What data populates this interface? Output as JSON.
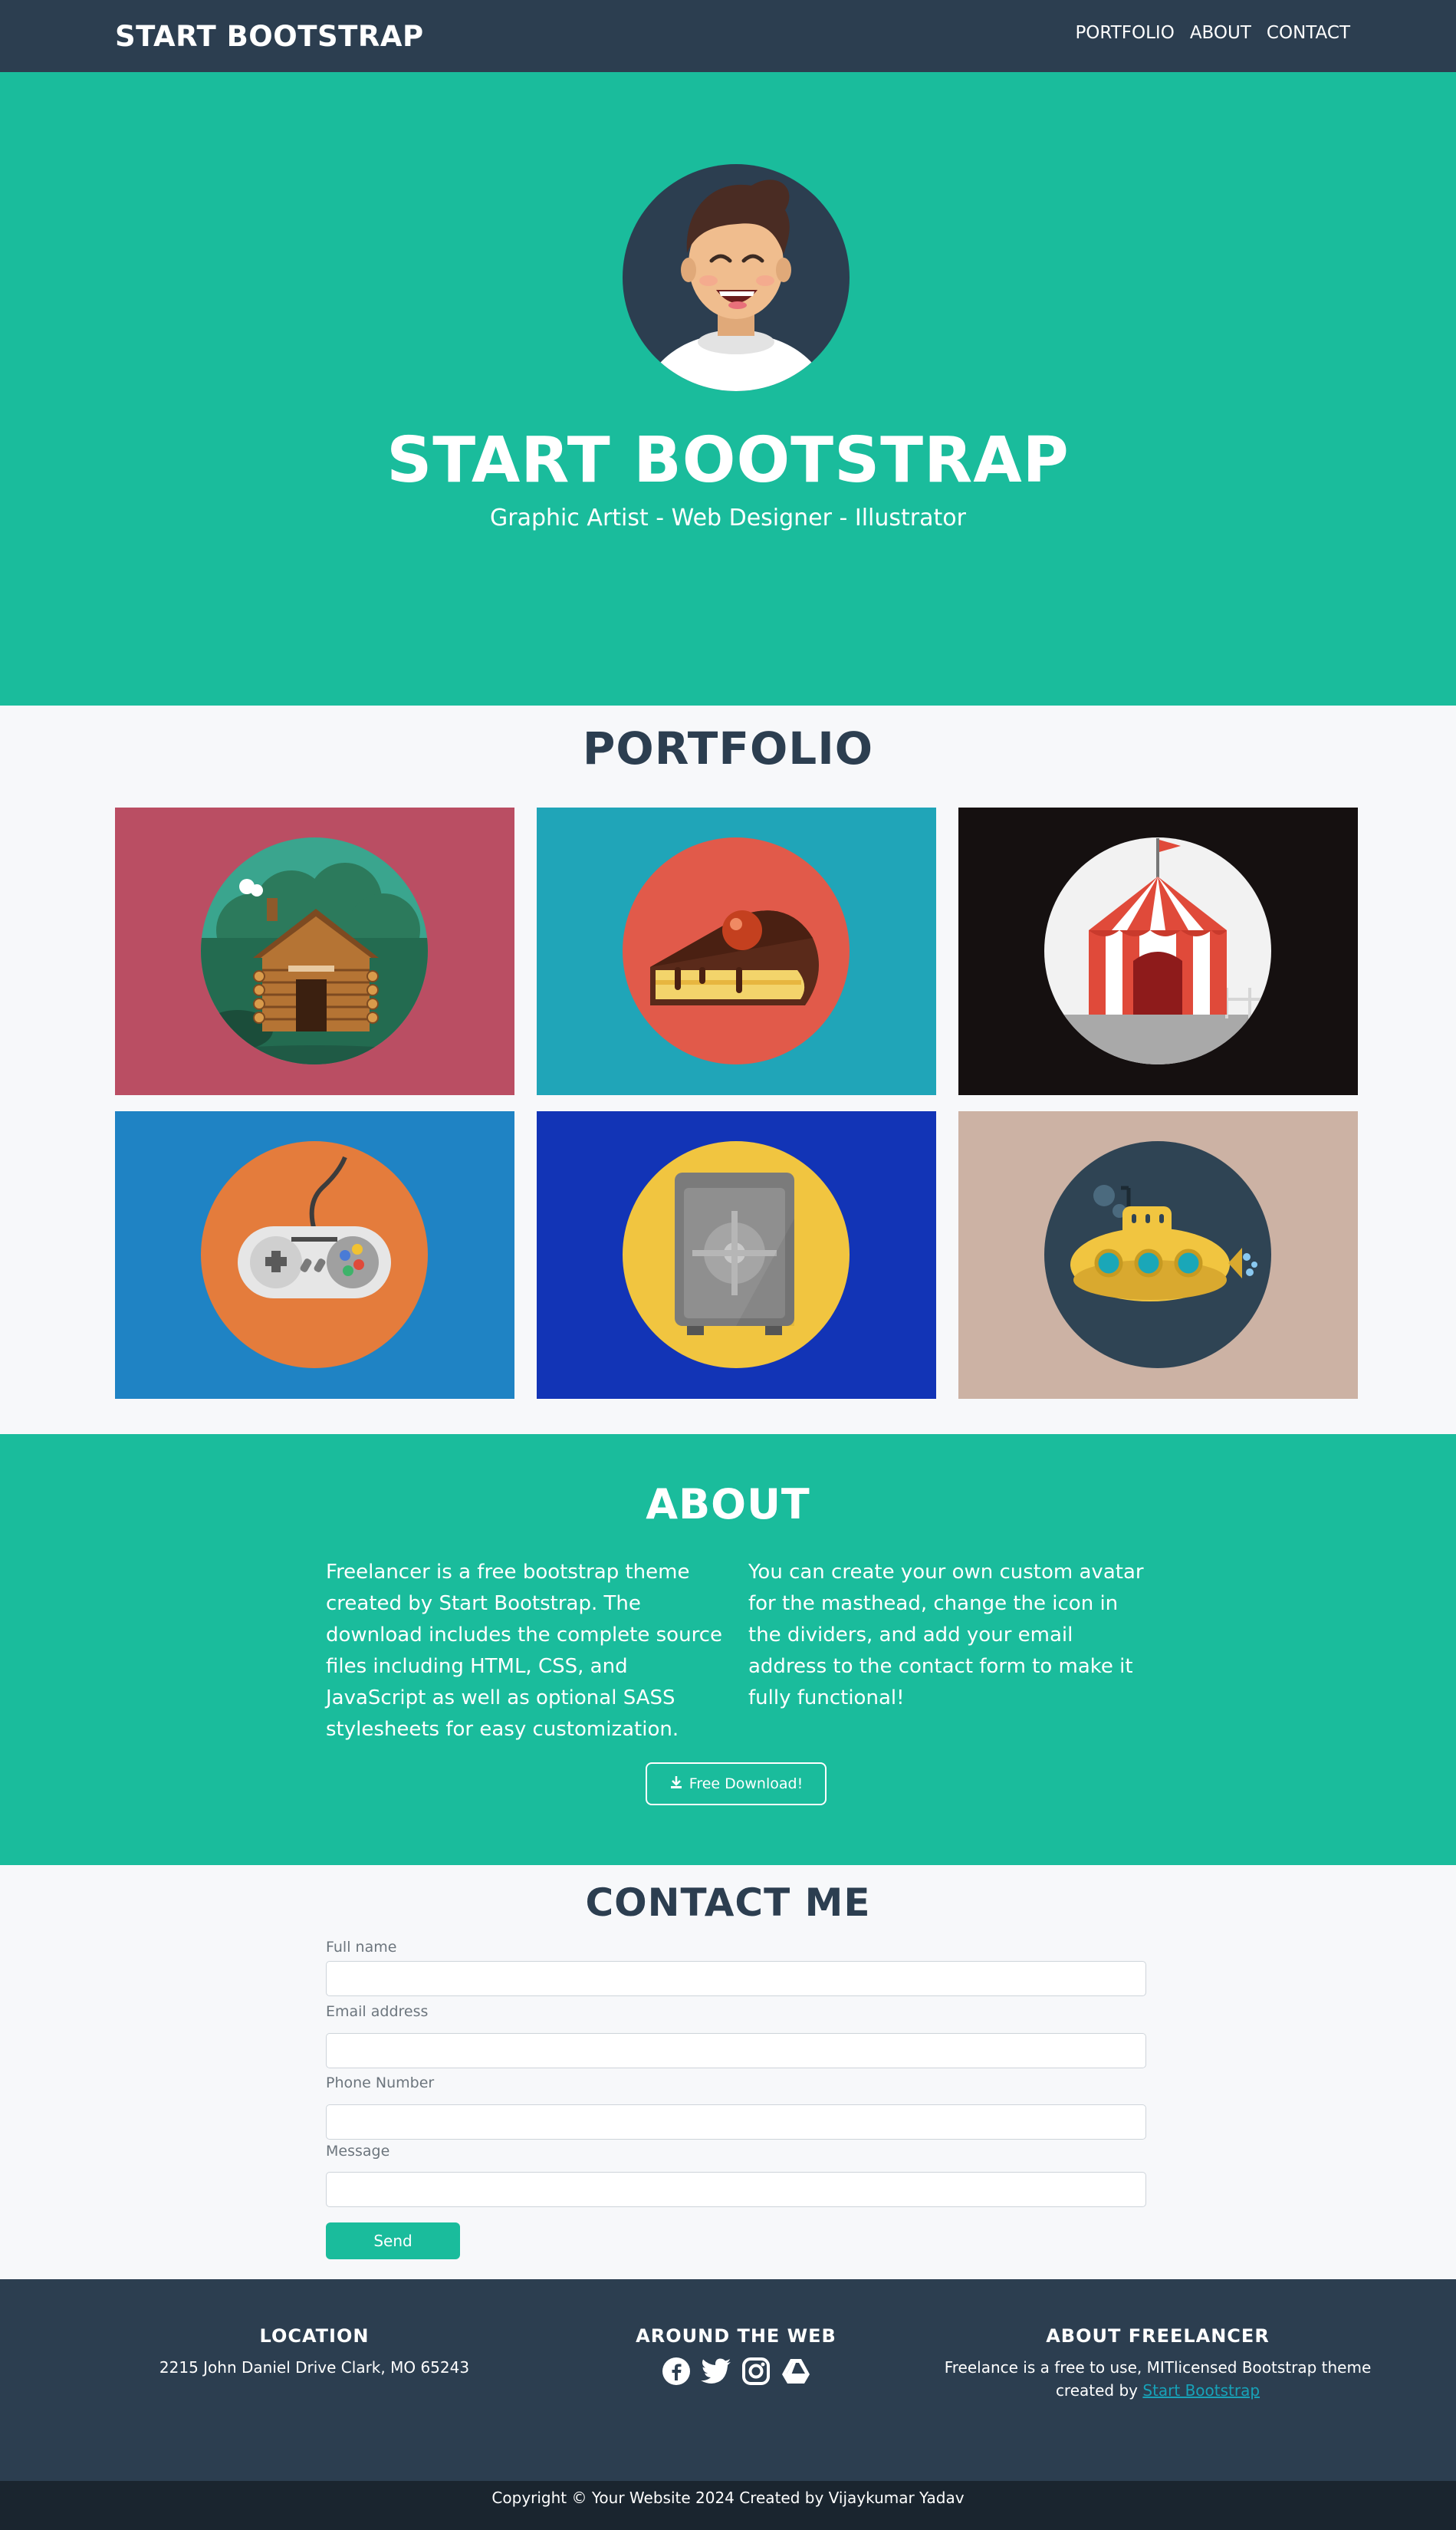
{
  "nav": {
    "brand": "START BOOTSTRAP",
    "links": [
      "PORTFOLIO",
      "ABOUT",
      "CONTACT"
    ]
  },
  "masthead": {
    "title": "START BOOTSTRAP",
    "subtitle": "Graphic Artist - Web Designer - Illustrator"
  },
  "portfolio": {
    "heading": "PORTFOLIO",
    "items": [
      {
        "icon": "cabin-icon",
        "bg": "#ba4e63"
      },
      {
        "icon": "cake-icon",
        "bg": "#20a5b8"
      },
      {
        "icon": "circus-tent-icon",
        "bg": "#151010"
      },
      {
        "icon": "game-controller-icon",
        "bg": "#1f83c4"
      },
      {
        "icon": "safe-icon",
        "bg": "#1234b6"
      },
      {
        "icon": "submarine-icon",
        "bg": "#ccb2a4"
      }
    ]
  },
  "about": {
    "heading": "ABOUT",
    "left": "Freelancer is a free bootstrap theme created by Start Bootstrap. The download includes the complete source files including HTML, CSS, and JavaScript as well as optional SASS stylesheets for easy customization.",
    "right": "You can create your own custom avatar for the masthead, change the icon in the dividers, and add your email address to the contact form to make it fully functional!",
    "button": "Free Download!"
  },
  "contact": {
    "heading": "CONTACT ME",
    "fields": {
      "name_label": "Full name",
      "email_label": "Email address",
      "phone_label": "Phone Number",
      "message_label": "Message"
    },
    "send": "Send"
  },
  "footer": {
    "location_title": "LOCATION",
    "location_text": "2215 John Daniel Drive Clark, MO 65243",
    "web_title": "AROUND THE WEB",
    "social": [
      "facebook-icon",
      "twitter-icon",
      "instagram-icon",
      "google-drive-icon"
    ],
    "about_title": "ABOUT FREELANCER",
    "about_text": "Freelance is a free to use, MITlicensed Bootstrap theme created by",
    "about_link": "Start Bootstrap"
  },
  "copyright": "Copyright © Your Website 2024 Created by Vijaykumar Yadav",
  "colors": {
    "primary": "#1abc9c",
    "dark": "#2c3e50",
    "darker": "#1a252f",
    "light": "#f7f8fa"
  }
}
